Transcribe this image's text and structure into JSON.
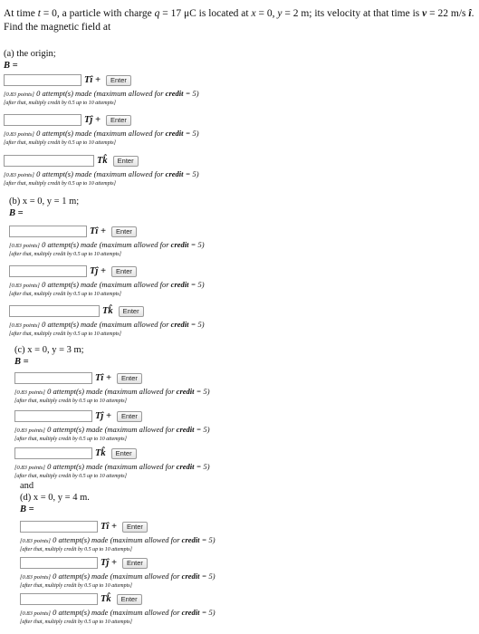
{
  "problem": {
    "intro": "At time ",
    "t_var": "t",
    "t_eq": " = 0, a particle with charge ",
    "q_var": "q",
    "q_eq": " = 17 μC is located at ",
    "pos_x_var": "x",
    "pos_x_eq": " = 0, ",
    "pos_y_var": "y",
    "pos_y_eq": " = 2 m; its velocity at that time is ",
    "v_var": "v",
    "v_eq": " = 22 m/s ",
    "v_unit": "î",
    "tail": ". Find the magnetic field at"
  },
  "b_label": "B =",
  "enter_label": "Enter",
  "status": {
    "points": "[0.83 points]",
    "attempts": "0 attempt(s) made (maximum allowed for ",
    "credit": "credit",
    "max": " = 5)"
  },
  "note": "[after that, multiply credit by 0.5 up to 10 attempts]",
  "units": {
    "i": "Tî +",
    "j": "Tĵ +",
    "k": "Tk̂"
  },
  "parts": [
    {
      "title": "(a) the origin;"
    },
    {
      "title": "(b) x = 0, y = 1 m;"
    },
    {
      "title": "(c) x = 0, y = 3 m;"
    },
    {
      "title": "and"
    },
    {
      "title": "(d) x = 0, y = 4 m."
    }
  ]
}
